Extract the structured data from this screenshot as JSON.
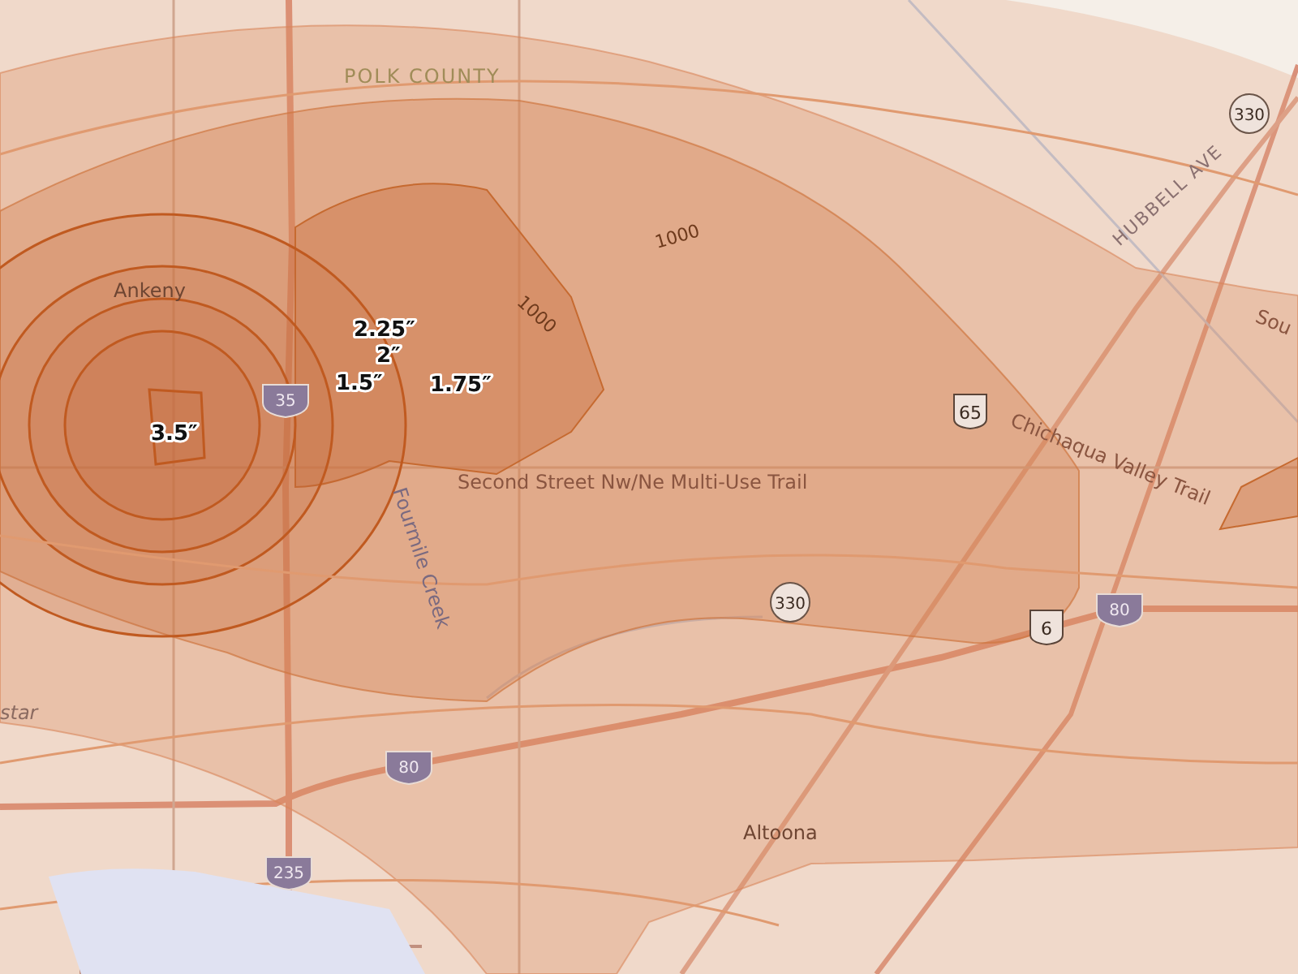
{
  "map": {
    "place_labels": [
      {
        "kind": "county",
        "text": "POLK COUNTY"
      },
      {
        "kind": "city",
        "text": "Ankeny"
      },
      {
        "kind": "trail",
        "text": "Second Street Nw/Ne Multi-Use Trail"
      },
      {
        "kind": "waterway",
        "text": "Fourmile Creek"
      },
      {
        "kind": "elevation",
        "text": "1000"
      },
      {
        "kind": "elevation",
        "text": "1000"
      },
      {
        "kind": "street",
        "text": "HUBBELL AVE"
      },
      {
        "kind": "trail",
        "text": "Chichaqua Valley Trail"
      },
      {
        "kind": "trail",
        "text": "Sou"
      },
      {
        "kind": "city",
        "text": "Altoona"
      },
      {
        "kind": "locality",
        "text": "star"
      }
    ],
    "snowfall_labels": [
      {
        "text": "2.25″"
      },
      {
        "text": "2″"
      },
      {
        "text": "1.5″"
      },
      {
        "text": "1.75″"
      },
      {
        "text": "3.5″"
      }
    ],
    "route_shields": [
      {
        "kind": "interstate",
        "number": "35"
      },
      {
        "kind": "state",
        "number": "330"
      },
      {
        "kind": "us",
        "number": "65"
      },
      {
        "kind": "state",
        "number": "330"
      },
      {
        "kind": "us",
        "number": "6"
      },
      {
        "kind": "interstate",
        "number": "80"
      },
      {
        "kind": "interstate",
        "number": "80"
      },
      {
        "kind": "interstate",
        "number": "235"
      }
    ]
  }
}
